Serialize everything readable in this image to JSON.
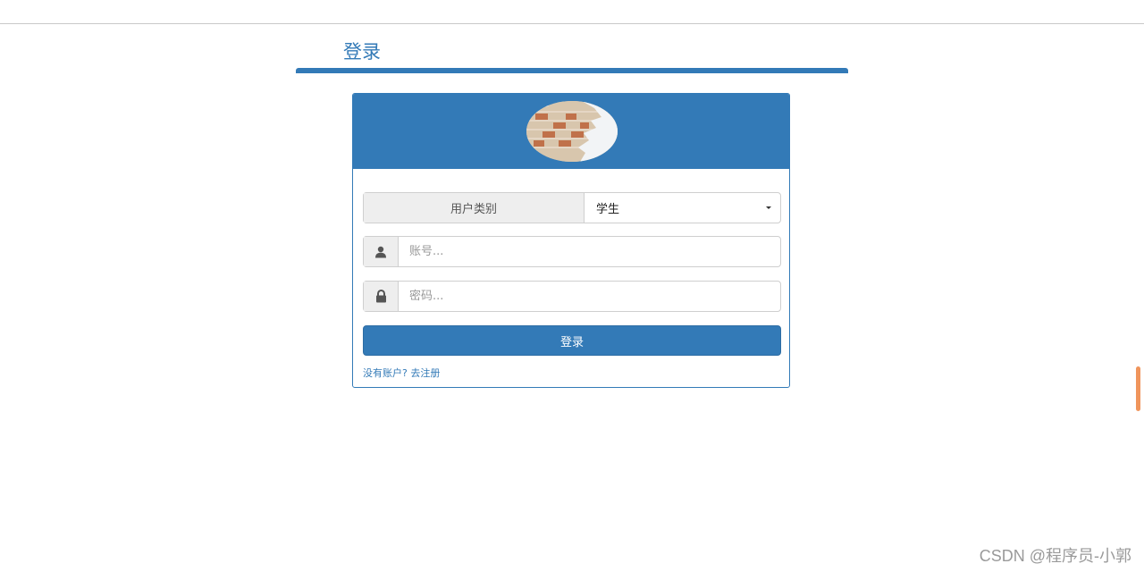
{
  "page": {
    "title": "登录"
  },
  "login": {
    "user_type_label": "用户类别",
    "user_type_selected": "学生",
    "account_placeholder": "账号...",
    "password_placeholder": "密码...",
    "submit_label": "登录",
    "no_account_text": "没有账户?",
    "register_link": "去注册"
  },
  "icons": {
    "account": "user-icon",
    "password": "lock-icon",
    "select": "caret-down-icon"
  },
  "colors": {
    "primary": "#337ab7",
    "addon_bg": "#eeeeee",
    "scroll_accent": "#ee8a4a"
  },
  "watermark": {
    "text": "CSDN @程序员-小郭"
  }
}
